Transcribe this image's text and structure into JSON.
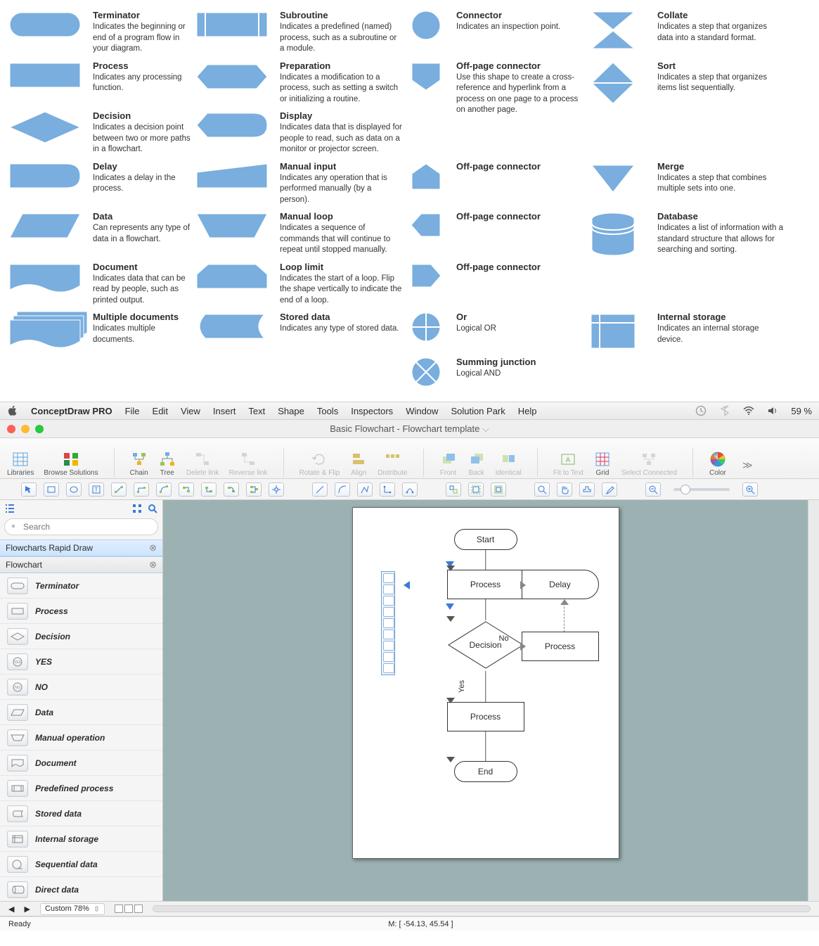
{
  "flowchart_shapes": {
    "col1": [
      {
        "name": "Terminator",
        "desc": "Indicates the beginning or end of a program flow in your diagram."
      },
      {
        "name": "Process",
        "desc": "Indicates any processing function."
      },
      {
        "name": "Decision",
        "desc": "Indicates a decision point between two or more paths in a flowchart."
      },
      {
        "name": "Delay",
        "desc": "Indicates a delay in the process."
      },
      {
        "name": "Data",
        "desc": "Can represents any type of data in a flowchart."
      },
      {
        "name": "Document",
        "desc": "Indicates data that can be read by people, such as printed output."
      },
      {
        "name": "Multiple documents",
        "desc": "Indicates multiple documents."
      }
    ],
    "col2": [
      {
        "name": "Subroutine",
        "desc": "Indicates a predefined (named) process, such as a subroutine or a module."
      },
      {
        "name": "Preparation",
        "desc": "Indicates a modification to a process, such as setting a switch or initializing a routine."
      },
      {
        "name": "Display",
        "desc": "Indicates data that is displayed for people to read, such as data on a monitor or projector screen."
      },
      {
        "name": "Manual input",
        "desc": "Indicates any operation that is performed manually (by a person)."
      },
      {
        "name": "Manual loop",
        "desc": "Indicates a sequence of commands that will continue to repeat until stopped manually."
      },
      {
        "name": "Loop limit",
        "desc": "Indicates the start of a loop. Flip the shape vertically to indicate the end of a loop."
      },
      {
        "name": "Stored data",
        "desc": "Indicates any type of stored data."
      }
    ],
    "col3": [
      {
        "name": "Connector",
        "desc": "Indicates an inspection point."
      },
      {
        "name": "Off-page connector",
        "desc": "Use this shape to create a cross-reference and hyperlink from a process on one page to a process on another page."
      },
      {
        "name": "Off-page connector",
        "desc": ""
      },
      {
        "name": "Off-page connector",
        "desc": ""
      },
      {
        "name": "Off-page connector",
        "desc": ""
      },
      {
        "name": "Or",
        "desc": "Logical OR"
      },
      {
        "name": "Summing junction",
        "desc": "Logical AND"
      }
    ],
    "col4": [
      {
        "name": "Collate",
        "desc": "Indicates a step that organizes data into a standard format."
      },
      {
        "name": "Sort",
        "desc": "Indicates a step that organizes items list sequentially."
      },
      {
        "name": "Merge",
        "desc": "Indicates a step that combines multiple sets into one."
      },
      {
        "name": "Database",
        "desc": "Indicates a list of information with a standard structure that allows for searching and sorting."
      },
      {
        "name": "Internal storage",
        "desc": "Indicates an internal storage device."
      }
    ]
  },
  "menubar": {
    "app": "ConceptDraw PRO",
    "items": [
      "File",
      "Edit",
      "View",
      "Insert",
      "Text",
      "Shape",
      "Tools",
      "Inspectors",
      "Window",
      "Solution Park",
      "Help"
    ],
    "battery": "59 %"
  },
  "titlebar": {
    "title": "Basic Flowchart - Flowchart template"
  },
  "ribbon": {
    "libraries": "Libraries",
    "browse": "Browse Solutions",
    "chain": "Chain",
    "tree": "Tree",
    "deletelink": "Delete link",
    "reverselink": "Reverse link",
    "rotate": "Rotate & Flip",
    "align": "Align",
    "distribute": "Distribute",
    "front": "Front",
    "back": "Back",
    "identical": "Identical",
    "fit": "Fit to Text",
    "grid": "Grid",
    "selconn": "Select Connected",
    "color": "Color"
  },
  "sidebar": {
    "search_placeholder": "Search",
    "sections": [
      "Flowcharts Rapid Draw",
      "Flowchart"
    ],
    "items": [
      "Terminator",
      "Process",
      "Decision",
      "YES",
      "NO",
      "Data",
      "Manual operation",
      "Document",
      "Predefined process",
      "Stored data",
      "Internal storage",
      "Sequential data",
      "Direct data"
    ]
  },
  "canvas": {
    "nodes": {
      "start": "Start",
      "process1": "Process",
      "delay": "Delay",
      "decision": "Decision",
      "no": "No",
      "yes": "Yes",
      "process2": "Process",
      "process3": "Process",
      "end": "End"
    }
  },
  "bottombar": {
    "zoom": "Custom 78%",
    "coords": "M: [ -54.13, 45.54 ]",
    "ready": "Ready"
  }
}
